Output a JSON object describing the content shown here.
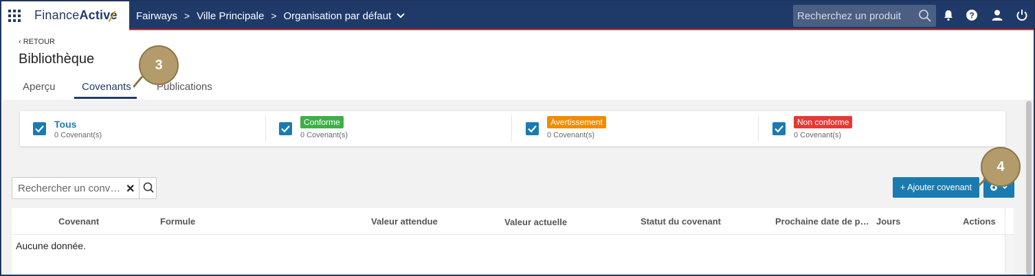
{
  "topbar": {
    "logo_light": "Finance",
    "logo_bold": "Active",
    "breadcrumb": [
      "Fairways",
      "Ville Principale",
      "Organisation par défaut"
    ],
    "search_placeholder": "Recherchez un produit",
    "icons": [
      "apps-grid-icon",
      "bell-icon",
      "help-icon",
      "user-icon",
      "power-icon"
    ]
  },
  "page": {
    "back_label": "‹ RETOUR",
    "title": "Bibliothèque",
    "tabs": [
      {
        "label": "Aperçu",
        "active": false
      },
      {
        "label": "Covenants",
        "active": true
      },
      {
        "label": "Publications",
        "active": false
      }
    ]
  },
  "filters": [
    {
      "label": "Tous",
      "count": "0 Covenant(s)",
      "checked": true
    },
    {
      "label": "Conforme",
      "count": "0 Covenant(s)",
      "checked": true,
      "color": "#3fae49"
    },
    {
      "label": "Avertissement",
      "count": "0 Covenant(s)",
      "checked": true,
      "color": "#f28b00"
    },
    {
      "label": "Non conforme",
      "count": "0 Covenant(s)",
      "checked": true,
      "color": "#e53935"
    }
  ],
  "toolbar": {
    "search_placeholder": "Rechercher un conv…",
    "add_label": "+ Ajouter covenant"
  },
  "table": {
    "columns": [
      "Covenant",
      "Formule",
      "Valeur attendue",
      "Valeur actuelle",
      "Statut du covenant",
      "Prochaine date de p…",
      "Jours",
      "Actions"
    ],
    "empty_text": "Aucune donnée."
  },
  "callouts": [
    "3",
    "4"
  ],
  "colors": {
    "navy": "#1f3a68",
    "accent": "#1a7bb0"
  }
}
